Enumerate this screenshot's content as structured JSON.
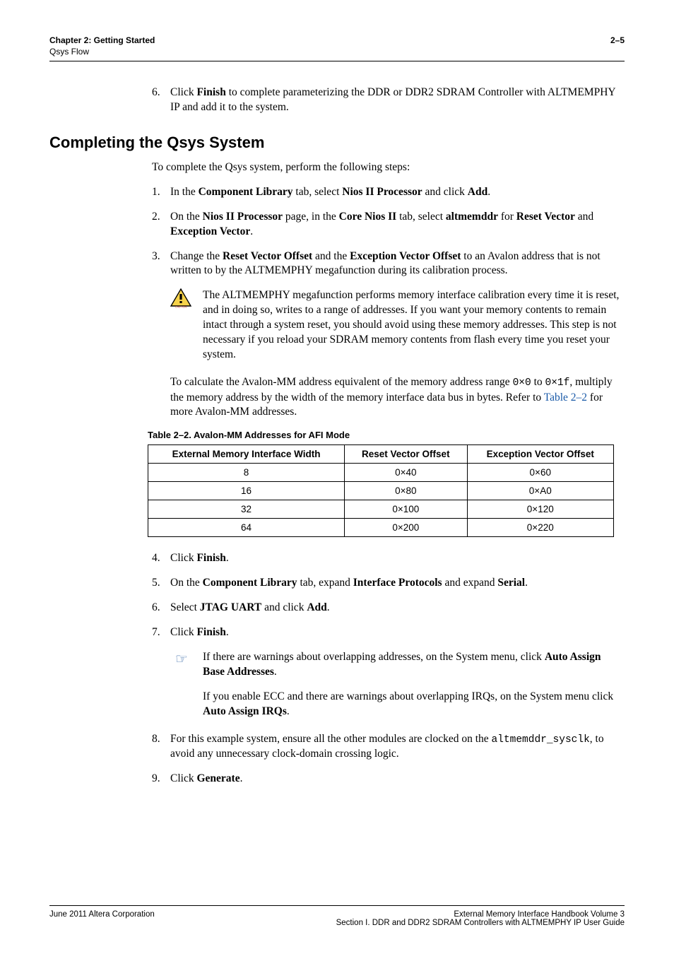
{
  "header": {
    "chapter": "Chapter 2: Getting Started",
    "sub": "Qsys Flow",
    "page": "2–5"
  },
  "step6": {
    "num": "6.",
    "pre": "Click ",
    "b1": "Finish",
    "post": " to complete parameterizing the DDR or DDR2 SDRAM Controller with ALTMEMPHY IP and add it to the system."
  },
  "sectionTitle": "Completing the Qsys System",
  "intro": "To complete the Qsys system, perform the following steps:",
  "s1": {
    "num": "1.",
    "t1": "In the ",
    "b1": "Component Library",
    "t2": " tab, select ",
    "b2": "Nios II Processor",
    "t3": " and click ",
    "b3": "Add",
    "t4": "."
  },
  "s2": {
    "num": "2.",
    "t1": "On the ",
    "b1": "Nios II Processor",
    "t2": " page, in the ",
    "b2": "Core Nios II",
    "t3": " tab, select ",
    "b3": "altmemddr",
    "t4": " for ",
    "b4": "Reset Vector",
    "t5": " and ",
    "b5": "Exception Vector",
    "t6": "."
  },
  "s3": {
    "num": "3.",
    "t1": "Change the ",
    "b1": "Reset Vector Offset",
    "t2": " and the ",
    "b2": "Exception Vector Offset",
    "t3": " to an Avalon address that is not written to by the ALTMEMPHY megafunction during its calibration process."
  },
  "caution": "The ALTMEMPHY megafunction performs memory interface calibration every time it is reset, and in doing so, writes to a range of addresses. If you want your memory contents to remain intact through a system reset, you should avoid using these memory addresses. This step is not necessary if you reload your SDRAM memory contents from flash every time you reset your system.",
  "calc": {
    "t1": "To calculate the Avalon-MM address equivalent of the memory address range ",
    "m1": "0×0",
    "t2": " to ",
    "m2": "0×1f",
    "t3": ", multiply the memory address by the width of the memory interface data bus in bytes. Refer to ",
    "link": "Table 2–2",
    "t4": " for more Avalon-MM addresses."
  },
  "tableCaption": "Table 2–2.  Avalon-MM Addresses for AFI Mode",
  "tableHeaders": [
    "External Memory Interface Width",
    "Reset Vector Offset",
    "Exception Vector Offset"
  ],
  "chart_data": {
    "type": "table",
    "title": "Avalon-MM Addresses for AFI Mode",
    "columns": [
      "External Memory Interface Width",
      "Reset Vector Offset",
      "Exception Vector Offset"
    ],
    "rows": [
      [
        "8",
        "0×40",
        "0×60"
      ],
      [
        "16",
        "0×80",
        "0×A0"
      ],
      [
        "32",
        "0×100",
        "0×120"
      ],
      [
        "64",
        "0×200",
        "0×220"
      ]
    ]
  },
  "s4": {
    "num": "4.",
    "t1": "Click ",
    "b1": "Finish",
    "t2": "."
  },
  "s5": {
    "num": "5.",
    "t1": "On the ",
    "b1": "Component Library",
    "t2": " tab, expand ",
    "b2": "Interface Protocols",
    "t3": " and expand ",
    "b3": "Serial",
    "t4": "."
  },
  "s6": {
    "num": "6.",
    "t1": "Select ",
    "b1": "JTAG UART",
    "t2": " and click ",
    "b2": "Add",
    "t3": "."
  },
  "s7": {
    "num": "7.",
    "t1": "Click ",
    "b1": "Finish",
    "t2": "."
  },
  "note1": {
    "t1": "If there are warnings about overlapping addresses, on the System menu, click ",
    "b1": "Auto Assign Base Addresses",
    "t2": "."
  },
  "note2": {
    "t1": "If you enable ECC and there are warnings about overlapping IRQs, on the System menu click ",
    "b1": "Auto Assign IRQs",
    "t2": "."
  },
  "s8": {
    "num": "8.",
    "t1": "For this example system, ensure all the other modules are clocked on the ",
    "m1": "altmemddr_sysclk",
    "t2": ", to avoid any unnecessary clock-domain crossing logic."
  },
  "s9": {
    "num": "9.",
    "t1": "Click ",
    "b1": "Generate",
    "t2": "."
  },
  "footer": {
    "left": "June 2011   Altera Corporation",
    "r1": "External Memory Interface Handbook Volume 3",
    "r2": "Section I. DDR and DDR2 SDRAM Controllers with ALTMEMPHY IP User Guide"
  }
}
